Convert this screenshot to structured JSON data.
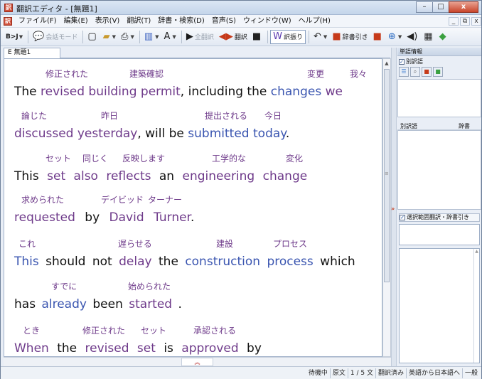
{
  "window": {
    "title": "翻訳エディタ - [無題1]",
    "app_icon_glyph": "訳",
    "buttons": {
      "minimize": "–",
      "maximize": "□",
      "close": "x"
    }
  },
  "menu": {
    "items": [
      "ファイル(F)",
      "編集(E)",
      "表示(V)",
      "翻訳(T)",
      "辞書・検索(D)",
      "音声(S)",
      "ウィンドウ(W)",
      "ヘルプ(H)"
    ],
    "doc_controls": [
      "_",
      "⧉",
      "x"
    ]
  },
  "toolbar": {
    "bj": "B>J",
    "conversation_mode": "会話モード",
    "translate_all": "全翻訳",
    "translate": "翻訳",
    "retranslate": "訳振り",
    "dictionary_lookup": "辞書引き"
  },
  "editor": {
    "tab_label": "E 無題1",
    "lines": [
      {
        "ruby": [
          "修正された",
          "建築確認",
          "変更",
          "我々"
        ]
      },
      {
        "english": [
          "The",
          "revised",
          "building permit",
          ", including the",
          "changes",
          "we"
        ]
      },
      {
        "ruby": [
          "論じた",
          "昨日",
          "提出される",
          "今日"
        ]
      },
      {
        "english": [
          "discussed",
          "yesterday",
          ", will be",
          "submitted",
          "today",
          "."
        ]
      },
      {
        "ruby": [
          "セット",
          "同じく",
          "反映します",
          "工学的な",
          "変化"
        ]
      },
      {
        "english": [
          "This",
          "set",
          "also",
          "reflects",
          "an",
          "engineering",
          "change"
        ]
      },
      {
        "ruby": [
          "求められた",
          "デイビッド",
          "ターナー"
        ]
      },
      {
        "english": [
          "requested",
          "by",
          "David",
          "Turner",
          "."
        ]
      },
      {
        "ruby": [
          "これ",
          "遅らせる",
          "建設",
          "プロセス"
        ]
      },
      {
        "english": [
          "This",
          "should not",
          "delay",
          "the",
          "construction",
          "process",
          "which"
        ]
      },
      {
        "ruby": [
          "すでに",
          "始められた"
        ]
      },
      {
        "english": [
          "has",
          "already",
          "been",
          "started",
          "."
        ]
      },
      {
        "ruby": [
          "とき",
          "修正された",
          "セット",
          "承認される"
        ]
      },
      {
        "english": [
          "When",
          "the",
          "revised",
          "set",
          "is",
          "approved",
          "by"
        ]
      }
    ]
  },
  "right_panel": {
    "header": "単語情報",
    "alt_translation_check": "別訳語",
    "alt_translation_col": "別訳語",
    "dictionary_col": "辞書",
    "selection_check": "選択範囲翻訳・辞書引き"
  },
  "status_bar": [
    "待機中",
    "原文",
    "1 / 5 文",
    "翻訳済み",
    "英語から日本語へ",
    "一般"
  ],
  "colors": {
    "ruby": "#6e3a8a",
    "link_blue": "#3a55b0",
    "close_red": "#c9452b"
  }
}
